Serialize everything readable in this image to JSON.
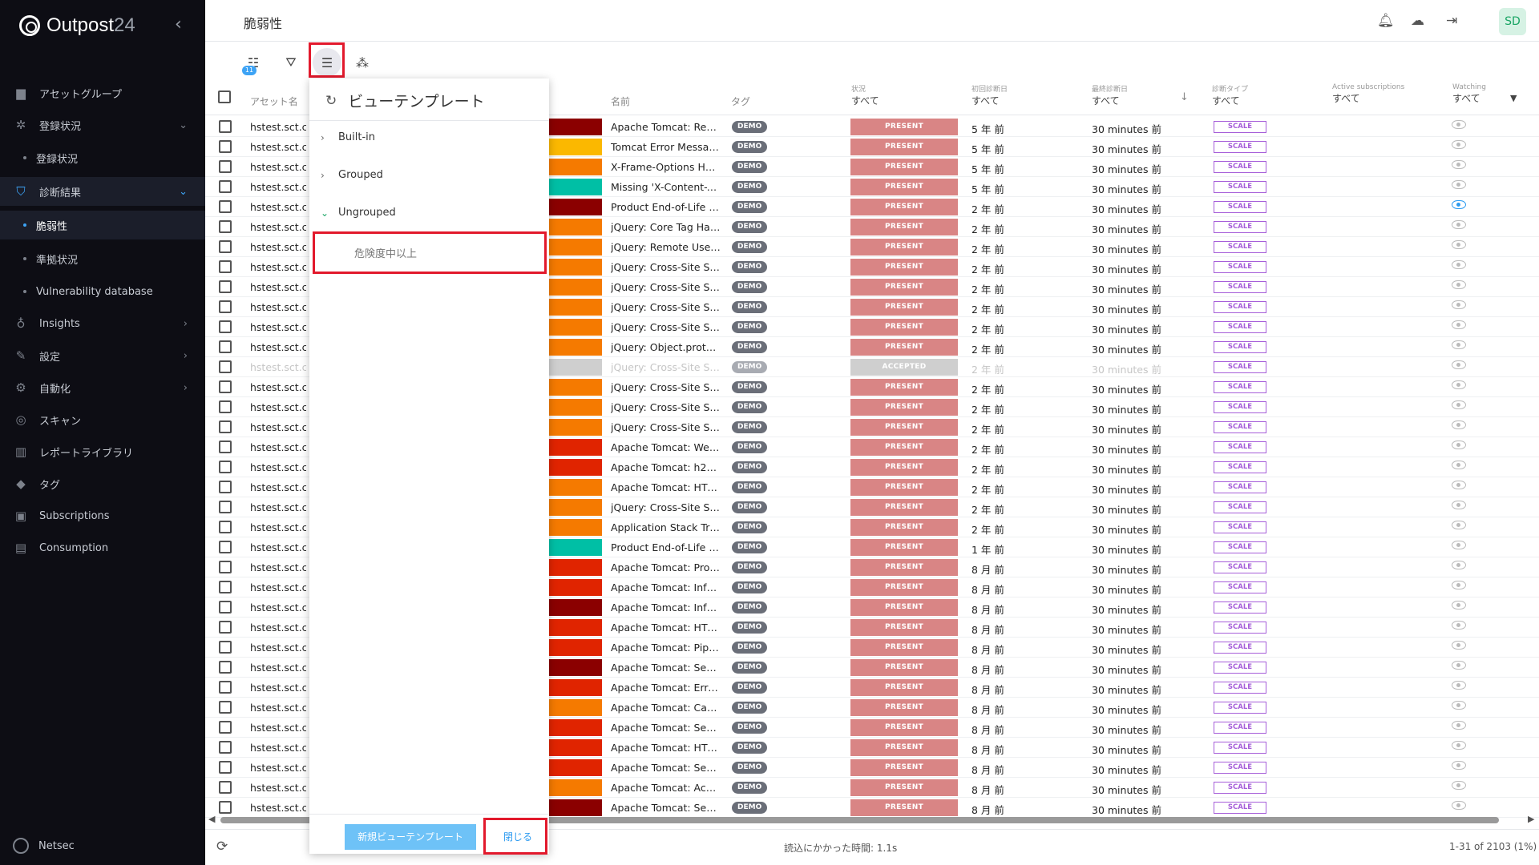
{
  "sidebar": {
    "brand": "Outpost",
    "brand_version": "24",
    "items": [
      {
        "label": "アセットグループ",
        "icon": "folder-icon"
      },
      {
        "label": "登録状況",
        "icon": "network-icon"
      },
      {
        "label": "登録状況",
        "icon": "dot"
      },
      {
        "label": "診断結果",
        "icon": "shield-icon"
      },
      {
        "label": "脆弱性",
        "icon": "dot"
      },
      {
        "label": "準拠状況",
        "icon": "dot"
      },
      {
        "label": "Vulnerability database",
        "icon": "dot"
      },
      {
        "label": "Insights",
        "icon": "bulb-icon"
      },
      {
        "label": "設定",
        "icon": "wrench-icon"
      },
      {
        "label": "自動化",
        "icon": "automation-icon"
      },
      {
        "label": "スキャン",
        "icon": "radar-icon"
      },
      {
        "label": "レポートライブラリ",
        "icon": "library-icon"
      },
      {
        "label": "タグ",
        "icon": "tag-icon"
      },
      {
        "label": "Subscriptions",
        "icon": "subscriptions-icon"
      },
      {
        "label": "Consumption",
        "icon": "consumption-icon"
      }
    ],
    "footer_label": "Netsec"
  },
  "header": {
    "title": "脆弱性",
    "avatar": "SD"
  },
  "toolbar": {
    "badge_count": "11"
  },
  "columns": {
    "asset": "アセット名",
    "name": "名前",
    "tag": "タグ",
    "state_label": "状況",
    "state_value": "すべて",
    "first_label": "初回診断日",
    "first_value": "すべて",
    "last_label": "最終診断日",
    "last_value": "すべて",
    "type_label": "診断タイプ",
    "type_value": "すべて",
    "subs_label": "Active subscriptions",
    "subs_value": "すべて",
    "watching_label": "Watching",
    "watching_value": "すべて"
  },
  "colors": {
    "critical": "#8b0000",
    "high": "#e02400",
    "medium": "#f57a00",
    "low": "#fbb800",
    "info": "#00bfa5",
    "accepted": "#cfcfcf"
  },
  "rows": [
    {
      "asset": "hstest.sct.co",
      "sev": "critical",
      "name": "Apache Tomcat: Rem...",
      "tag": "DEMO",
      "state": "PRESENT",
      "first": "5 年 前",
      "last": "30 minutes 前",
      "type": "SCALE",
      "watch": false
    },
    {
      "asset": "hstest.sct.co",
      "sev": "low",
      "name": "Tomcat Error Message",
      "tag": "DEMO",
      "state": "PRESENT",
      "first": "5 年 前",
      "last": "30 minutes 前",
      "type": "SCALE",
      "watch": false
    },
    {
      "asset": "hstest.sct.co",
      "sev": "medium",
      "name": "X-Frame-Options Hea...",
      "tag": "DEMO",
      "state": "PRESENT",
      "first": "5 年 前",
      "last": "30 minutes 前",
      "type": "SCALE",
      "watch": false
    },
    {
      "asset": "hstest.sct.co",
      "sev": "info",
      "name": "Missing 'X-Content-Ty...",
      "tag": "DEMO",
      "state": "PRESENT",
      "first": "5 年 前",
      "last": "30 minutes 前",
      "type": "SCALE",
      "watch": false
    },
    {
      "asset": "hstest.sct.co",
      "sev": "critical",
      "name": "Product End-of-Life (...",
      "tag": "DEMO",
      "state": "PRESENT",
      "first": "2 年 前",
      "last": "30 minutes 前",
      "type": "SCALE",
      "watch": true
    },
    {
      "asset": "hstest.sct.co",
      "sev": "medium",
      "name": "jQuery: Core Tag Han...",
      "tag": "DEMO",
      "state": "PRESENT",
      "first": "2 年 前",
      "last": "30 minutes 前",
      "type": "SCALE",
      "watch": false
    },
    {
      "asset": "hstest.sct.co",
      "sev": "medium",
      "name": "jQuery: Remote User ...",
      "tag": "DEMO",
      "state": "PRESENT",
      "first": "2 年 前",
      "last": "30 minutes 前",
      "type": "SCALE",
      "watch": false
    },
    {
      "asset": "hstest.sct.co",
      "sev": "medium",
      "name": "jQuery: Cross-Site Scr...",
      "tag": "DEMO",
      "state": "PRESENT",
      "first": "2 年 前",
      "last": "30 minutes 前",
      "type": "SCALE",
      "watch": false
    },
    {
      "asset": "hstest.sct.co",
      "sev": "medium",
      "name": "jQuery: Cross-Site Scr...",
      "tag": "DEMO",
      "state": "PRESENT",
      "first": "2 年 前",
      "last": "30 minutes 前",
      "type": "SCALE",
      "watch": false
    },
    {
      "asset": "hstest.sct.co",
      "sev": "medium",
      "name": "jQuery: Cross-Site Scr...",
      "tag": "DEMO",
      "state": "PRESENT",
      "first": "2 年 前",
      "last": "30 minutes 前",
      "type": "SCALE",
      "watch": false
    },
    {
      "asset": "hstest.sct.co",
      "sev": "medium",
      "name": "jQuery: Cross-Site Scr...",
      "tag": "DEMO",
      "state": "PRESENT",
      "first": "2 年 前",
      "last": "30 minutes 前",
      "type": "SCALE",
      "watch": false
    },
    {
      "asset": "hstest.sct.co",
      "sev": "medium",
      "name": "jQuery: Object.prototy...",
      "tag": "DEMO",
      "state": "PRESENT",
      "first": "2 年 前",
      "last": "30 minutes 前",
      "type": "SCALE",
      "watch": false
    },
    {
      "asset": "hstest.sct.co",
      "sev": "accepted",
      "name": "jQuery: Cross-Site Scr...",
      "tag": "DEMO",
      "state": "ACCEPTED",
      "first": "2 年 前",
      "last": "30 minutes 前",
      "type": "SCALE",
      "watch": false,
      "muted": true
    },
    {
      "asset": "hstest.sct.co",
      "sev": "medium",
      "name": "jQuery: Cross-Site Scr...",
      "tag": "DEMO",
      "state": "PRESENT",
      "first": "2 年 前",
      "last": "30 minutes 前",
      "type": "SCALE",
      "watch": false
    },
    {
      "asset": "hstest.sct.co",
      "sev": "medium",
      "name": "jQuery: Cross-Site Scr...",
      "tag": "DEMO",
      "state": "PRESENT",
      "first": "2 年 前",
      "last": "30 minutes 前",
      "type": "SCALE",
      "watch": false
    },
    {
      "asset": "hstest.sct.co",
      "sev": "medium",
      "name": "jQuery: Cross-Site Scr...",
      "tag": "DEMO",
      "state": "PRESENT",
      "first": "2 年 前",
      "last": "30 minutes 前",
      "type": "SCALE",
      "watch": false
    },
    {
      "asset": "hstest.sct.co",
      "sev": "high",
      "name": "Apache Tomcat: Web...",
      "tag": "DEMO",
      "state": "PRESENT",
      "first": "2 年 前",
      "last": "30 minutes 前",
      "type": "SCALE",
      "watch": false
    },
    {
      "asset": "hstest.sct.co",
      "sev": "high",
      "name": "Apache Tomcat: h2c ...",
      "tag": "DEMO",
      "state": "PRESENT",
      "first": "2 年 前",
      "last": "30 minutes 前",
      "type": "SCALE",
      "watch": false
    },
    {
      "asset": "hstest.sct.co",
      "sev": "medium",
      "name": "Apache Tomcat: HTT...",
      "tag": "DEMO",
      "state": "PRESENT",
      "first": "2 年 前",
      "last": "30 minutes 前",
      "type": "SCALE",
      "watch": false
    },
    {
      "asset": "hstest.sct.co",
      "sev": "medium",
      "name": "jQuery: Cross-Site Scr...",
      "tag": "DEMO",
      "state": "PRESENT",
      "first": "2 年 前",
      "last": "30 minutes 前",
      "type": "SCALE",
      "watch": false
    },
    {
      "asset": "hstest.sct.co",
      "sev": "medium",
      "name": "Application Stack Tra...",
      "tag": "DEMO",
      "state": "PRESENT",
      "first": "2 年 前",
      "last": "30 minutes 前",
      "type": "SCALE",
      "watch": false
    },
    {
      "asset": "hstest.sct.co",
      "sev": "info",
      "name": "Product End-of-Life (...",
      "tag": "DEMO",
      "state": "PRESENT",
      "first": "1 年 前",
      "last": "30 minutes 前",
      "type": "SCALE",
      "watch": false
    },
    {
      "asset": "hstest.sct.co",
      "sev": "high",
      "name": "Apache Tomcat: Proc...",
      "tag": "DEMO",
      "state": "PRESENT",
      "first": "8 月 前",
      "last": "30 minutes 前",
      "type": "SCALE",
      "watch": false
    },
    {
      "asset": "hstest.sct.co",
      "sev": "high",
      "name": "Apache Tomcat: Infor...",
      "tag": "DEMO",
      "state": "PRESENT",
      "first": "8 月 前",
      "last": "30 minutes 前",
      "type": "SCALE",
      "watch": false
    },
    {
      "asset": "hstest.sct.co",
      "sev": "critical",
      "name": "Apache Tomcat: Infor...",
      "tag": "DEMO",
      "state": "PRESENT",
      "first": "8 月 前",
      "last": "30 minutes 前",
      "type": "SCALE",
      "watch": false
    },
    {
      "asset": "hstest.sct.co",
      "sev": "high",
      "name": "Apache Tomcat: HTT...",
      "tag": "DEMO",
      "state": "PRESENT",
      "first": "8 月 前",
      "last": "30 minutes 前",
      "type": "SCALE",
      "watch": false
    },
    {
      "asset": "hstest.sct.co",
      "sev": "high",
      "name": "Apache Tomcat: Pipe...",
      "tag": "DEMO",
      "state": "PRESENT",
      "first": "8 月 前",
      "last": "30 minutes 前",
      "type": "SCALE",
      "watch": false
    },
    {
      "asset": "hstest.sct.co",
      "sev": "critical",
      "name": "Apache Tomcat: Sec...",
      "tag": "DEMO",
      "state": "PRESENT",
      "first": "8 月 前",
      "last": "30 minutes 前",
      "type": "SCALE",
      "watch": false
    },
    {
      "asset": "hstest.sct.co",
      "sev": "high",
      "name": "Apache Tomcat: Error...",
      "tag": "DEMO",
      "state": "PRESENT",
      "first": "8 月 前",
      "last": "30 minutes 前",
      "type": "SCALE",
      "watch": false
    },
    {
      "asset": "hstest.sct.co",
      "sev": "medium",
      "name": "Apache Tomcat: Cac...",
      "tag": "DEMO",
      "state": "PRESENT",
      "first": "8 月 前",
      "last": "30 minutes 前",
      "type": "SCALE",
      "watch": false
    },
    {
      "asset": "hstest.sct.co",
      "sev": "high",
      "name": "Apache Tomcat: Sec...",
      "tag": "DEMO",
      "state": "PRESENT",
      "first": "8 月 前",
      "last": "30 minutes 前",
      "type": "SCALE",
      "watch": false
    },
    {
      "asset": "hstest.sct.co",
      "sev": "high",
      "name": "Apache Tomcat: HTT...",
      "tag": "DEMO",
      "state": "PRESENT",
      "first": "8 月 前",
      "last": "30 minutes 前",
      "type": "SCALE",
      "watch": false
    },
    {
      "asset": "hstest.sct.co",
      "sev": "high",
      "name": "Apache Tomcat: Sec...",
      "tag": "DEMO",
      "state": "PRESENT",
      "first": "8 月 前",
      "last": "30 minutes 前",
      "type": "SCALE",
      "watch": false
    },
    {
      "asset": "hstest.sct.co",
      "sev": "medium",
      "name": "Apache Tomcat: Acc...",
      "tag": "DEMO",
      "state": "PRESENT",
      "first": "8 月 前",
      "last": "30 minutes 前",
      "type": "SCALE",
      "watch": false
    },
    {
      "asset": "hstest.sct.co",
      "sev": "critical",
      "name": "Apache Tomcat: Sec...",
      "tag": "DEMO",
      "state": "PRESENT",
      "first": "8 月 前",
      "last": "30 minutes 前",
      "type": "SCALE",
      "watch": false
    }
  ],
  "panel": {
    "title": "ビューテンプレート",
    "groups": [
      "Built-in",
      "Grouped",
      "Ungrouped"
    ],
    "template": "危険度中以上",
    "new_button": "新規ビューテンプレート",
    "close_button": "閉じる"
  },
  "footer": {
    "load_time": "読込にかかった時間: 1.1s",
    "count": "1-31 of 2103 (1%)"
  }
}
